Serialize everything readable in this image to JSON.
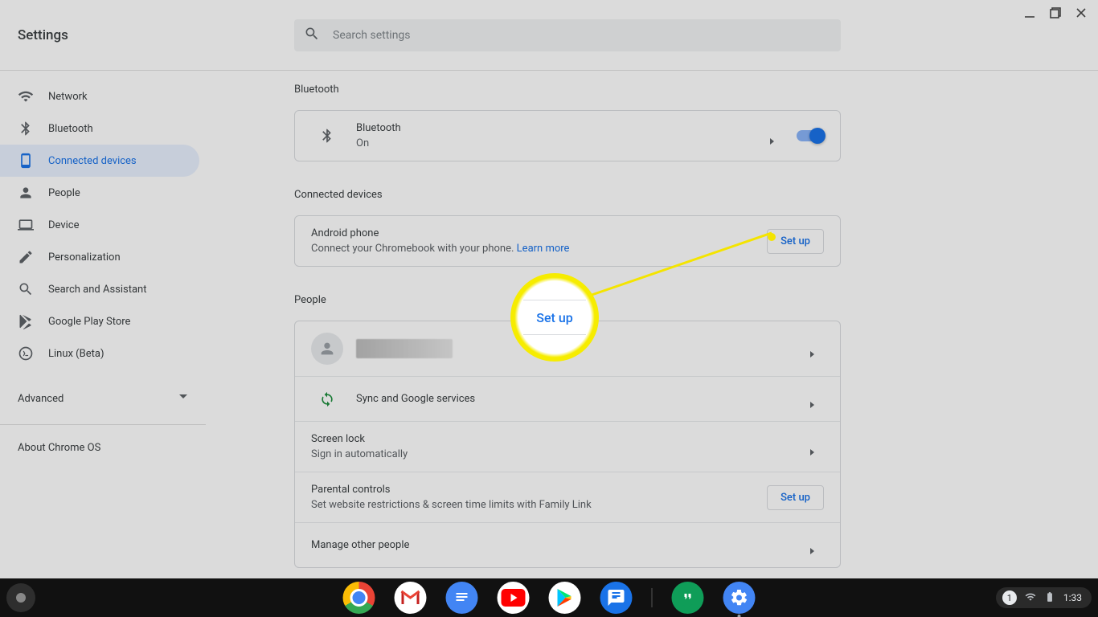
{
  "window": {
    "title": "Settings"
  },
  "header": {
    "searchPlaceholder": "Search settings"
  },
  "sidebar": {
    "items": [
      {
        "id": "network",
        "label": "Network"
      },
      {
        "id": "bluetooth",
        "label": "Bluetooth"
      },
      {
        "id": "connected-devices",
        "label": "Connected devices",
        "active": true
      },
      {
        "id": "people",
        "label": "People"
      },
      {
        "id": "device",
        "label": "Device"
      },
      {
        "id": "personalization",
        "label": "Personalization"
      },
      {
        "id": "search-assistant",
        "label": "Search and Assistant"
      },
      {
        "id": "play-store",
        "label": "Google Play Store"
      },
      {
        "id": "linux",
        "label": "Linux (Beta)"
      }
    ],
    "advanced": "Advanced",
    "about": "About Chrome OS"
  },
  "sections": {
    "bluetooth": {
      "title": "Bluetooth",
      "row": {
        "title": "Bluetooth",
        "status": "On",
        "toggleOn": true
      }
    },
    "connected": {
      "title": "Connected devices",
      "row": {
        "title": "Android phone",
        "desc": "Connect your Chromebook with your phone.",
        "learnMore": "Learn more",
        "button": "Set up"
      }
    },
    "people": {
      "title": "People",
      "rows": {
        "account": {
          "name": ""
        },
        "sync": {
          "title": "Sync and Google services"
        },
        "screenlock": {
          "title": "Screen lock",
          "sub": "Sign in automatically"
        },
        "parental": {
          "title": "Parental controls",
          "sub": "Set website restrictions & screen time limits with Family Link",
          "button": "Set up"
        },
        "manage": {
          "title": "Manage other people"
        }
      }
    }
  },
  "annotation": {
    "label": "Set up"
  },
  "shelf": {
    "apps": [
      {
        "id": "chrome",
        "name": "Chrome"
      },
      {
        "id": "gmail",
        "name": "Gmail"
      },
      {
        "id": "docs",
        "name": "Docs"
      },
      {
        "id": "youtube",
        "name": "YouTube"
      },
      {
        "id": "play",
        "name": "Play Store"
      },
      {
        "id": "messages",
        "name": "Messages"
      }
    ],
    "pinned": [
      {
        "id": "hangouts",
        "name": "Hangouts"
      },
      {
        "id": "settings",
        "name": "Settings",
        "running": true
      }
    ],
    "tray": {
      "notifications": "1",
      "time": "1:33"
    }
  }
}
